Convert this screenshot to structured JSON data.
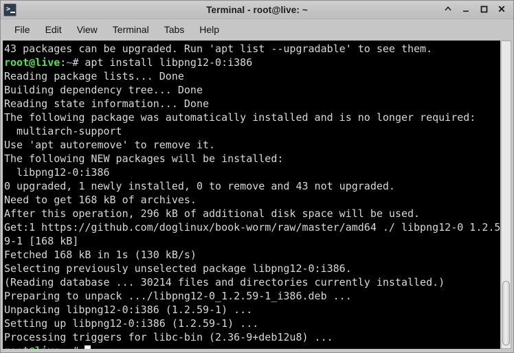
{
  "window": {
    "title": "Terminal - root@live: ~",
    "icon": "terminal-icon",
    "controls": [
      {
        "name": "shade-button",
        "glyph": "shade"
      },
      {
        "name": "minimize-button",
        "glyph": "minimize"
      },
      {
        "name": "maximize-button",
        "glyph": "maximize"
      },
      {
        "name": "close-button",
        "glyph": "close"
      }
    ]
  },
  "menubar": {
    "items": [
      {
        "label": "File"
      },
      {
        "label": "Edit"
      },
      {
        "label": "View"
      },
      {
        "label": "Terminal"
      },
      {
        "label": "Tabs"
      },
      {
        "label": "Help"
      }
    ]
  },
  "terminal": {
    "background": "#000000",
    "foreground": "#d8d8d8",
    "prompt_user_color": "#4ee44e",
    "prompt_path_color": "#4ec9e8",
    "prompt_user": "root@live",
    "prompt_sep": ":",
    "prompt_path": "~",
    "prompt_sigil": "# ",
    "lines": [
      {
        "type": "plain",
        "text": "43 packages can be upgraded. Run 'apt list --upgradable' to see them."
      },
      {
        "type": "prompt",
        "command": "apt install libpng12-0:i386"
      },
      {
        "type": "plain",
        "text": "Reading package lists... Done"
      },
      {
        "type": "plain",
        "text": "Building dependency tree... Done"
      },
      {
        "type": "plain",
        "text": "Reading state information... Done"
      },
      {
        "type": "plain",
        "text": "The following package was automatically installed and is no longer required:"
      },
      {
        "type": "plain",
        "text": "  multiarch-support"
      },
      {
        "type": "plain",
        "text": "Use 'apt autoremove' to remove it."
      },
      {
        "type": "plain",
        "text": "The following NEW packages will be installed:"
      },
      {
        "type": "plain",
        "text": "  libpng12-0:i386"
      },
      {
        "type": "plain",
        "text": "0 upgraded, 1 newly installed, 0 to remove and 43 not upgraded."
      },
      {
        "type": "plain",
        "text": "Need to get 168 kB of archives."
      },
      {
        "type": "plain",
        "text": "After this operation, 296 kB of additional disk space will be used."
      },
      {
        "type": "plain",
        "text": "Get:1 https://github.com/doglinux/book-worm/raw/master/amd64 ./ libpng12-0 1.2.5"
      },
      {
        "type": "plain",
        "text": "9-1 [168 kB]"
      },
      {
        "type": "plain",
        "text": "Fetched 168 kB in 1s (130 kB/s)"
      },
      {
        "type": "plain",
        "text": "Selecting previously unselected package libpng12-0:i386."
      },
      {
        "type": "plain",
        "text": "(Reading database ... 30214 files and directories currently installed.)"
      },
      {
        "type": "plain",
        "text": "Preparing to unpack .../libpng12-0_1.2.59-1_i386.deb ..."
      },
      {
        "type": "plain",
        "text": "Unpacking libpng12-0:i386 (1.2.59-1) ..."
      },
      {
        "type": "plain",
        "text": "Setting up libpng12-0:i386 (1.2.59-1) ..."
      },
      {
        "type": "plain",
        "text": "Processing triggers for libc-bin (2.36-9+deb12u8) ..."
      },
      {
        "type": "prompt-cursor",
        "command": ""
      }
    ]
  },
  "scrollbar": {
    "name": "vertical-scrollbar",
    "thumb_top_percent": 78,
    "thumb_height_percent": 21
  }
}
